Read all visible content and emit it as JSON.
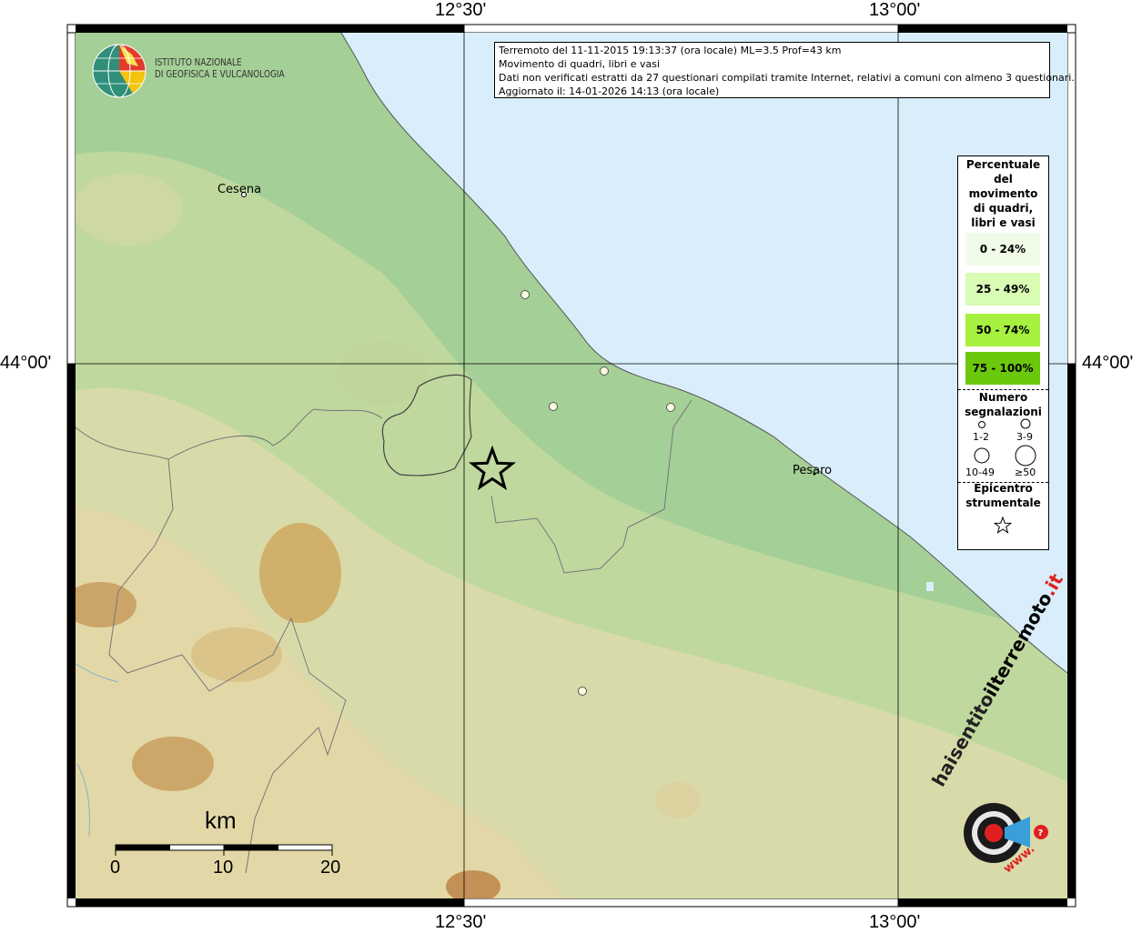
{
  "header": {
    "lines": [
      "Terremoto del 11-11-2015 19:13:37 (ora locale) ML=3.5 Prof=43 km",
      "Movimento di quadri, libri e vasi",
      "Dati non verificati estratti da 27 questionari compilati tramite Internet, relativi a comuni con almeno 3 questionari.",
      "Aggiornato il: 14-01-2026 14:13 (ora locale)"
    ]
  },
  "logo": {
    "line1": "ISTITUTO NAZIONALE",
    "line2": "DI GEOFISICA E VULCANOLOGIA",
    "icon": "ingv-globe-icon"
  },
  "coordinates": {
    "top_left": "12°30'",
    "top_right": "13°00'",
    "bottom_left": "12°30'",
    "bottom_right": "13°00'",
    "left": "44°00'",
    "right": "44°00'"
  },
  "cities": {
    "cesena": "Cesena",
    "pesaro": "Pesaro"
  },
  "legend": {
    "title_lines": [
      "Percentuale",
      "del",
      "movimento",
      "di quadri,",
      "libri e vasi"
    ],
    "classes": [
      {
        "label": "0 - 24%",
        "color": "#f0fce8"
      },
      {
        "label": "25 - 49%",
        "color": "#d8fcb4"
      },
      {
        "label": "50 - 74%",
        "color": "#a6f040"
      },
      {
        "label": "75 - 100%",
        "color": "#6cc80c"
      }
    ],
    "count_title_lines": [
      "Numero",
      "segnalazioni"
    ],
    "sizes": [
      "1-2",
      "3-9",
      "10-49",
      "≥50"
    ],
    "epicenter_title_lines": [
      "Epicentro",
      "strumentale"
    ],
    "epicenter_icon": "star-icon"
  },
  "scale_bar": {
    "unit": "km",
    "ticks": [
      "0",
      "10",
      "20"
    ]
  },
  "watermark": {
    "text1": "haisentito",
    "text2": "ilterremoto",
    "text3": ".it",
    "text4": "www.",
    "icon": "target-megaphone-icon"
  },
  "colors": {
    "sea": "#d9eefa",
    "lowland": "#a8d29a",
    "hills": "#e6dcae",
    "mountains": "#c89650",
    "point": "#fbfbe0"
  }
}
